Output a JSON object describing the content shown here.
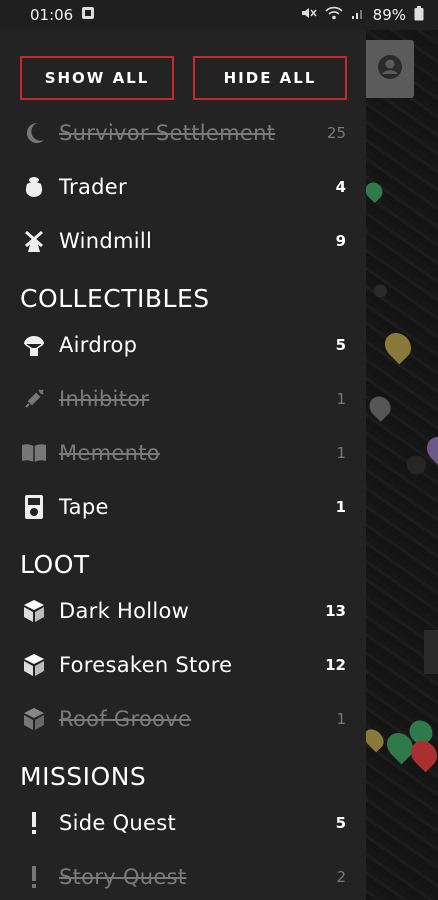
{
  "status_bar": {
    "time": "01:06",
    "battery": "89%"
  },
  "drawer": {
    "show_all_label": "SHOW ALL",
    "hide_all_label": "HIDE ALL",
    "top_items": [
      {
        "label": "Survivor Settlement",
        "count": "25",
        "enabled": false,
        "icon": "moon-icon"
      },
      {
        "label": "Trader",
        "count": "4",
        "enabled": true,
        "icon": "sack-icon"
      },
      {
        "label": "Windmill",
        "count": "9",
        "enabled": true,
        "icon": "windmill-icon"
      }
    ],
    "sections": [
      {
        "title": "COLLECTIBLES",
        "items": [
          {
            "label": "Airdrop",
            "count": "5",
            "enabled": true,
            "icon": "parachute-icon"
          },
          {
            "label": "Inhibitor",
            "count": "1",
            "enabled": false,
            "icon": "syringe-icon"
          },
          {
            "label": "Memento",
            "count": "1",
            "enabled": false,
            "icon": "book-icon"
          },
          {
            "label": "Tape",
            "count": "1",
            "enabled": true,
            "icon": "tape-player-icon"
          }
        ]
      },
      {
        "title": "LOOT",
        "items": [
          {
            "label": "Dark Hollow",
            "count": "13",
            "enabled": true,
            "icon": "cube-icon"
          },
          {
            "label": "Foresaken Store",
            "count": "12",
            "enabled": true,
            "icon": "cube-icon"
          },
          {
            "label": "Roof Groove",
            "count": "1",
            "enabled": false,
            "icon": "cube-icon"
          }
        ]
      },
      {
        "title": "MISSIONS",
        "items": [
          {
            "label": "Side Quest",
            "count": "5",
            "enabled": true,
            "icon": "exclamation-icon"
          },
          {
            "label": "Story Quest",
            "count": "2",
            "enabled": false,
            "icon": "exclamation-icon"
          }
        ]
      }
    ]
  },
  "colors": {
    "accent_red": "#c42a2a",
    "drawer_bg": "#232323",
    "disabled_text": "#7a7a7a"
  }
}
